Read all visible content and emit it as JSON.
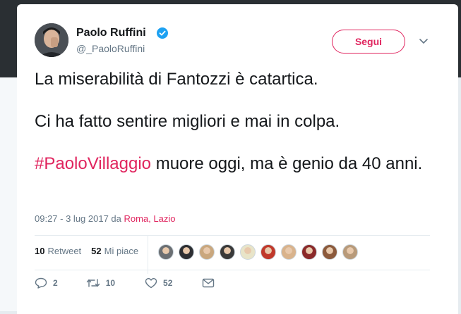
{
  "tweet": {
    "author_name": "Paolo Ruffini",
    "handle": "@_PaoloRuffini",
    "follow_label": "Segui",
    "text_line1": "La miserabilità di Fantozzi è catartica.",
    "text_line2": "Ci ha fatto sentire migliori e mai in colpa.",
    "hashtag": "#PaoloVillaggio",
    "text_line3_rest": " muore oggi, ma è genio da 40 anni.",
    "timestamp": "09:27 - 3 lug 2017",
    "location_prefix": " da ",
    "location": "Roma, Lazio"
  },
  "stats": {
    "retweets_count": "10",
    "retweets_label": "Retweet",
    "likes_count": "52",
    "likes_label": "Mi piace",
    "liker_avatar_colors": [
      "#6b6f73",
      "#2d2f33",
      "#c9a77e",
      "#3a3a3a",
      "#e8e4c8",
      "#c0392b",
      "#d9b38c",
      "#8b2a2a",
      "#8c5a3c",
      "#b89a7a"
    ]
  },
  "actions": {
    "reply_count": "2",
    "retweet_count": "10",
    "like_count": "52"
  },
  "colors": {
    "accent": "#e0245e",
    "verified": "#1da1f2",
    "muted": "#657786",
    "text": "#14171a"
  },
  "icons": [
    "verified-badge-icon",
    "chevron-down-icon",
    "reply-icon",
    "retweet-icon",
    "heart-icon",
    "envelope-icon"
  ]
}
